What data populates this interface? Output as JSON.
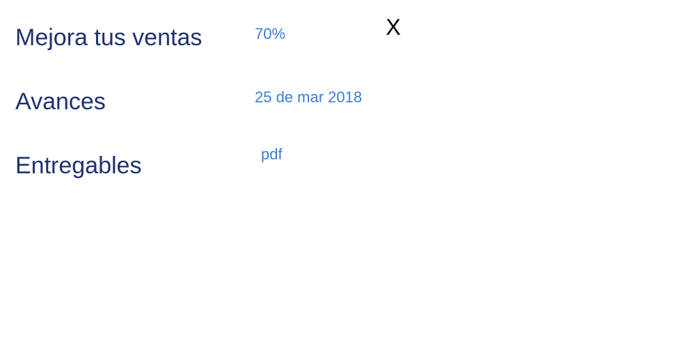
{
  "course": {
    "title": "Mejora tus ventas",
    "progress_value": "70%"
  },
  "rows": [
    {
      "label": "Avances",
      "value": "25 de mar 2018"
    },
    {
      "label": "Entregables",
      "value": "pdf"
    }
  ],
  "close": {
    "label": "X"
  },
  "colors": {
    "label": "#1f3170",
    "value": "#3a7fd6",
    "close": "#000000"
  }
}
